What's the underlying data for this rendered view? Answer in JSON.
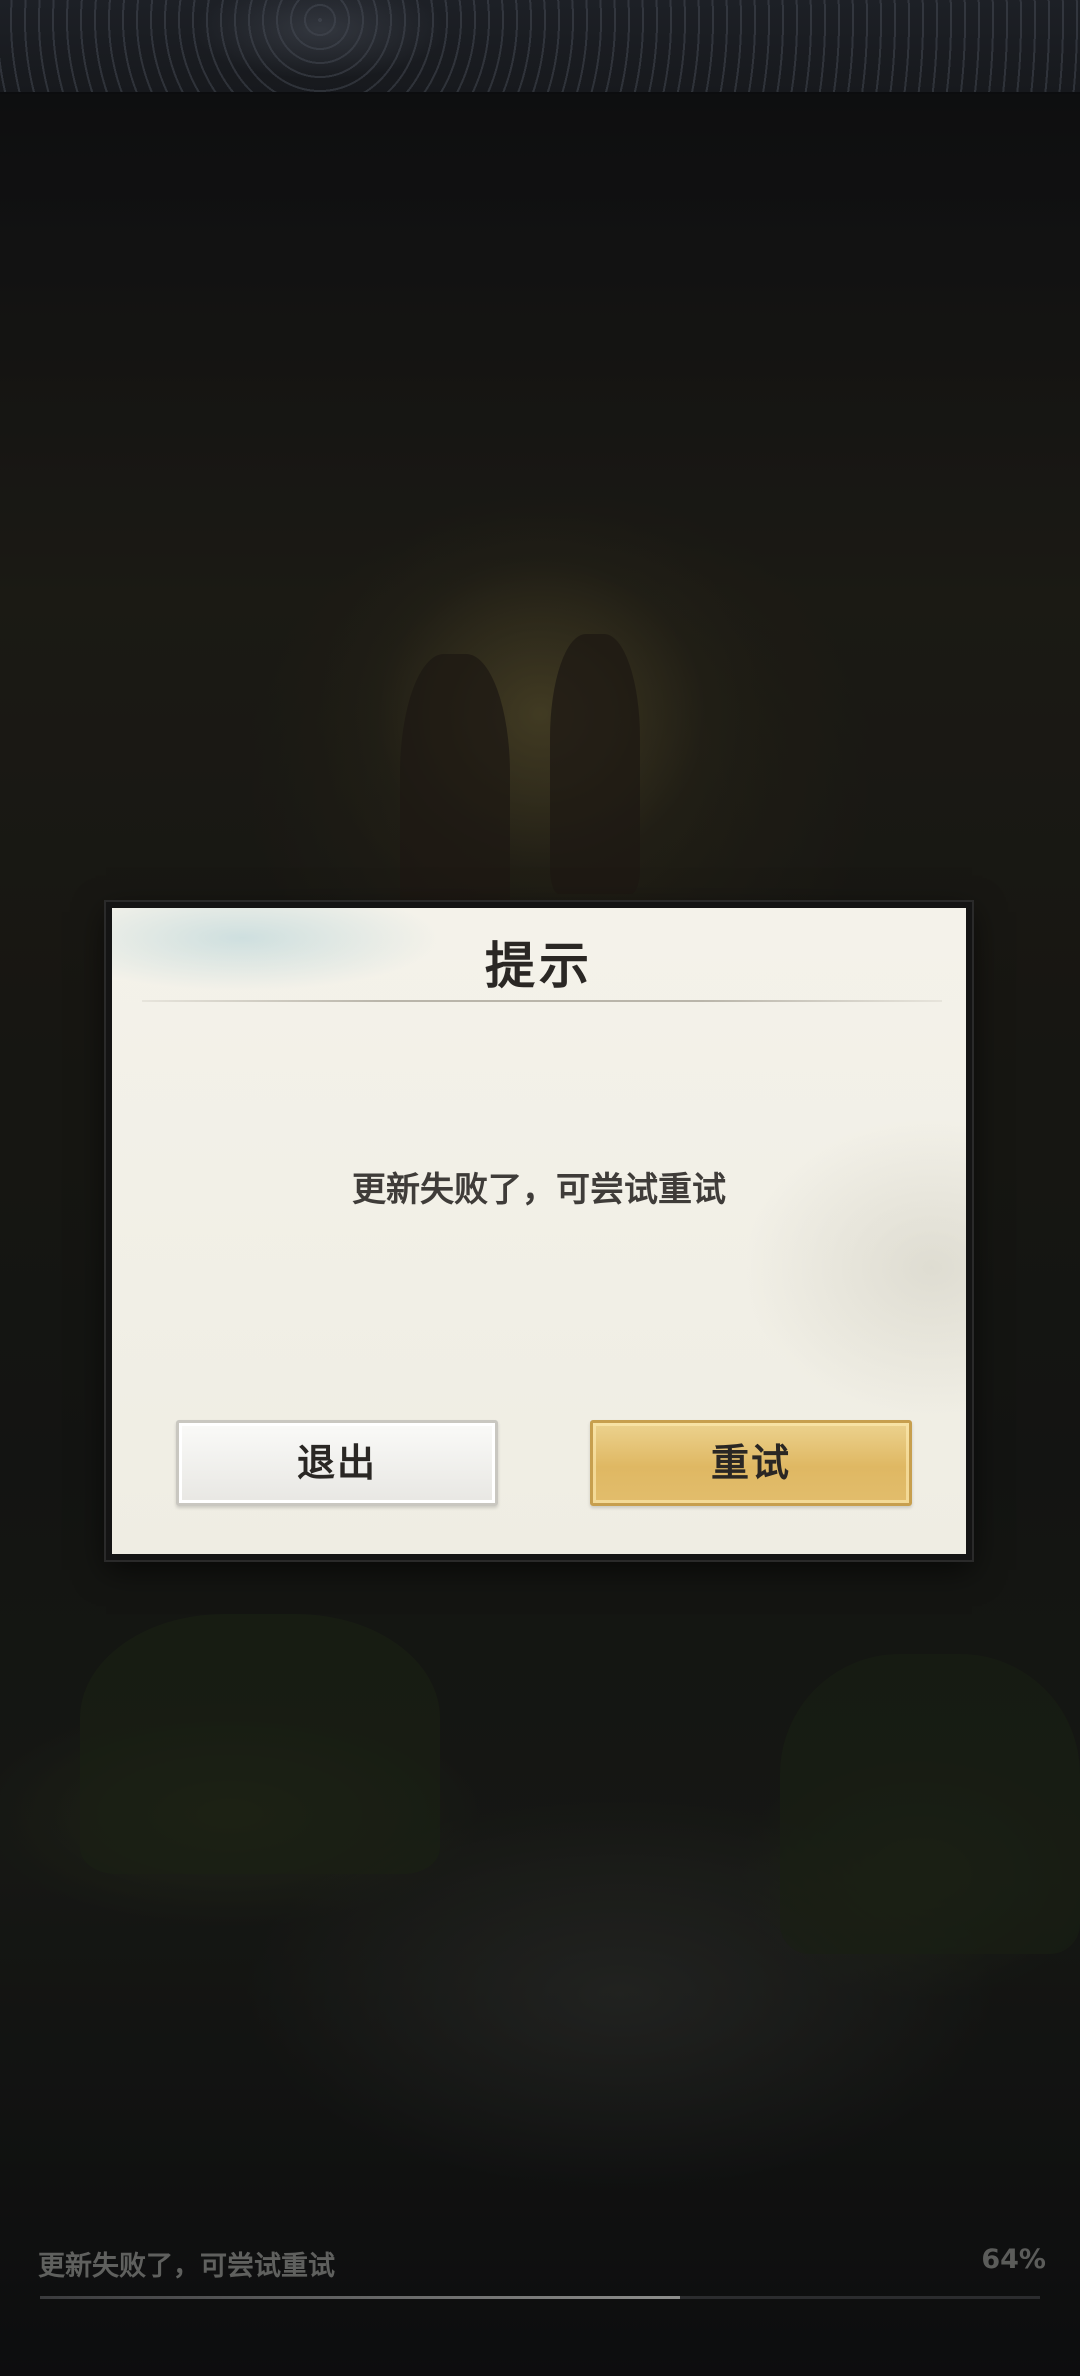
{
  "dialog": {
    "title": "提示",
    "message": "更新失败了，可尝试重试",
    "exit_label": "退出",
    "retry_label": "重试"
  },
  "status": {
    "text": "更新失败了，可尝试重试",
    "percent_label": "64%",
    "progress_fraction": 0.64
  },
  "colors": {
    "dialog_background": "#f2f0e8",
    "retry_button": "#e0bb68",
    "exit_button": "#f2f1ee",
    "title_text": "#2a2724"
  }
}
